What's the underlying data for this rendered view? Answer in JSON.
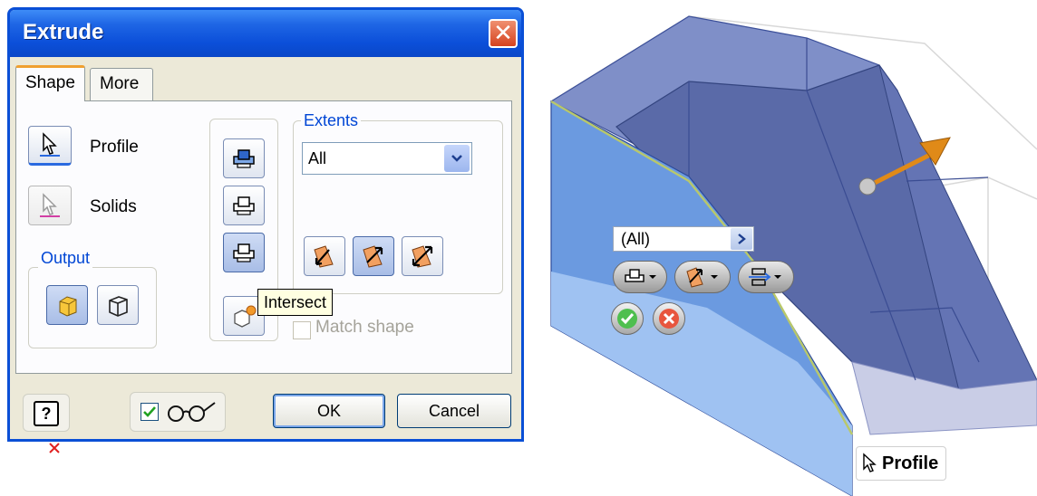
{
  "dialog": {
    "title": "Extrude",
    "tabs": [
      {
        "label": "Shape",
        "active": true
      },
      {
        "label": "More",
        "active": false
      }
    ],
    "selectors": {
      "profile_label": "Profile",
      "solids_label": "Solids"
    },
    "output": {
      "title": "Output",
      "options": [
        "solid-output-icon",
        "surface-output-icon"
      ],
      "selected": "solid-output-icon"
    },
    "operations": [
      "join-icon",
      "cut-icon",
      "intersect-icon",
      "new-solid-icon"
    ],
    "selected_operation": "intersect-icon",
    "tooltip": "Intersect",
    "extents": {
      "title": "Extents",
      "value": "All",
      "directions": [
        "direction-1-icon",
        "direction-2-icon",
        "symmetric-icon"
      ],
      "selected_direction": "direction-2-icon"
    },
    "match_shape": {
      "label": "Match shape",
      "checked": false,
      "enabled": false
    },
    "footer": {
      "help_icon": "help-icon",
      "preview_checked": true,
      "preview_icon": "glasses-icon",
      "ok_label": "OK",
      "cancel_label": "Cancel"
    }
  },
  "viewport": {
    "mini_toolbar": {
      "extents_value": "(All)",
      "buttons": [
        "operation-menu-icon",
        "direction-menu-icon",
        "output-menu-icon"
      ],
      "ok_icon": "checkmark-icon",
      "cancel_icon": "cancel-x-icon"
    },
    "profile_tag": "Profile"
  },
  "colors": {
    "title_blue": "#0b4fd9",
    "group_title": "#0046d5",
    "solid_fill": "#4a5ea8",
    "arrow": "#e08a18"
  }
}
